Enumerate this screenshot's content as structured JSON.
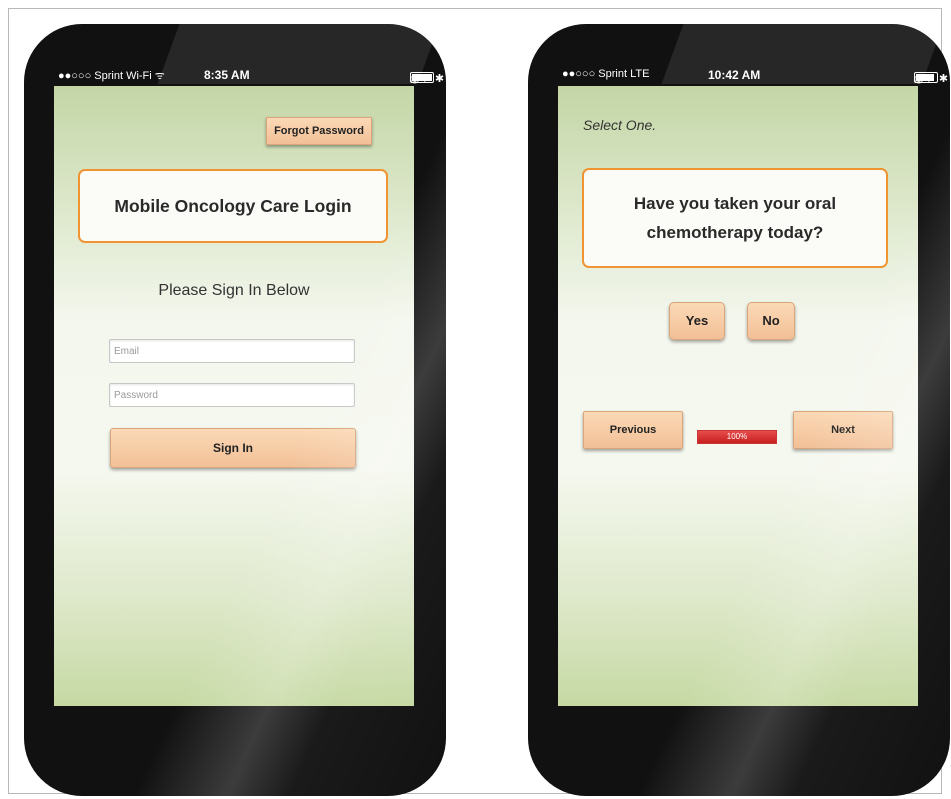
{
  "left_phone": {
    "status": {
      "carrier": "●●○○○ Sprint Wi-Fi ᯤ",
      "time": "8:35 AM",
      "indicators": "◉ ➚ ✱ 100%",
      "battery_level": 1.0
    },
    "forgot_password": "Forgot Password",
    "title": "Mobile Oncology Care Login",
    "prompt": "Please Sign In Below",
    "email_placeholder": "Email",
    "password_placeholder": "Password",
    "sign_in": "Sign In"
  },
  "right_phone": {
    "status": {
      "carrier": "●●○○○ Sprint  LTE",
      "time": "10:42 AM",
      "indicators": "◉ ➚ ✱ 93%",
      "battery_level": 0.93
    },
    "instruction": "Select One.",
    "question": "Have you taken your oral chemotherapy today?",
    "yes": "Yes",
    "no": "No",
    "previous": "Previous",
    "next": "Next",
    "progress": {
      "percent": 100,
      "label": "100%"
    }
  },
  "colors": {
    "accent_orange": "#f09433",
    "button_peach": "#f6c9a0",
    "progress_red": "#d62e2e",
    "screen_green": "#c4d6a6"
  }
}
